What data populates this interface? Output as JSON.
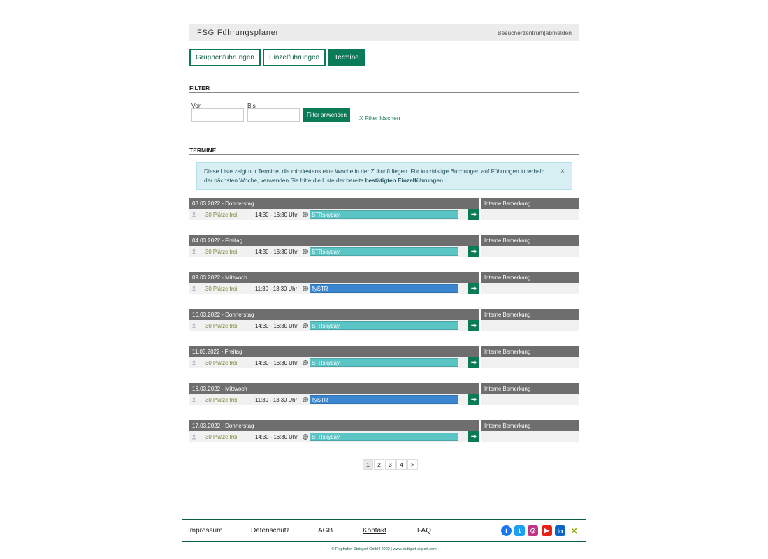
{
  "header": {
    "title": "FSG Führungsplaner",
    "visitor_center": "Besucherzentrum",
    "separator": "|",
    "logout": "abmelden"
  },
  "tabs": [
    {
      "label": "Gruppenführungen",
      "active": false
    },
    {
      "label": "Einzelführungen",
      "active": false
    },
    {
      "label": "Termine",
      "active": true
    }
  ],
  "filter": {
    "heading": "FILTER",
    "from_label": "Von",
    "to_label": "Bis",
    "from_value": "",
    "to_value": "",
    "apply_label": "Filter anwenden",
    "clear_label": "X Filter löschen"
  },
  "termine": {
    "heading": "TERMINE",
    "info_text_1": "Diese Liste zeigt nur Termine, die mindestens eine Woche in der Zukunft liegen. Für kurzfristige Buchungen auf Führungen innerhalb der nächsten Woche, verwenden Sie bitte die Liste der bereits ",
    "info_link": "bestätigten Einzelführungen",
    "info_text_2": " .",
    "close": "×",
    "remark_header": "Interne Bemerkung",
    "items": [
      {
        "date": "03.03.2022 - Donnerstag",
        "places": "30 Plätze frei",
        "time": "14:30 - 16:30 Uhr",
        "tour": "STRskyday",
        "color": "#5bc4c4"
      },
      {
        "date": "04.03.2022 - Freitag",
        "places": "30 Plätze frei",
        "time": "14:30 - 16:30 Uhr",
        "tour": "STRskyday",
        "color": "#5bc4c4"
      },
      {
        "date": "09.03.2022 - Mittwoch",
        "places": "30 Plätze frei",
        "time": "11:30 - 13:30 Uhr",
        "tour": "flySTR",
        "color": "#3a86d0"
      },
      {
        "date": "10.03.2022 - Donnerstag",
        "places": "30 Plätze frei",
        "time": "14:30 - 16:30 Uhr",
        "tour": "STRskyday",
        "color": "#5bc4c4"
      },
      {
        "date": "11.03.2022 - Freitag",
        "places": "30 Plätze frei",
        "time": "14:30 - 16:30 Uhr",
        "tour": "STRskyday",
        "color": "#5bc4c4"
      },
      {
        "date": "16.03.2022 - Mittwoch",
        "places": "30 Plätze frei",
        "time": "11:30 - 13:30 Uhr",
        "tour": "flySTR",
        "color": "#3a86d0"
      },
      {
        "date": "17.03.2022 - Donnerstag",
        "places": "30 Plätze frei",
        "time": "14:30 - 16:30 Uhr",
        "tour": "STRskyday",
        "color": "#5bc4c4"
      }
    ]
  },
  "pagination": {
    "pages": [
      "1",
      "2",
      "3",
      "4"
    ],
    "next": ">",
    "current": "1"
  },
  "footer": {
    "links": [
      {
        "label": "Impressum"
      },
      {
        "label": "Datenschutz"
      },
      {
        "label": "AGB"
      },
      {
        "label": "Kontakt"
      },
      {
        "label": "FAQ"
      }
    ],
    "social": [
      {
        "name": "facebook-icon",
        "glyph": "f",
        "color": "#1877f2"
      },
      {
        "name": "twitter-icon",
        "glyph": "t",
        "color": "#1da1f2"
      },
      {
        "name": "instagram-icon",
        "glyph": "◎",
        "color": "#c13584"
      },
      {
        "name": "youtube-icon",
        "glyph": "▶",
        "color": "#e62117"
      },
      {
        "name": "linkedin-icon",
        "glyph": "in",
        "color": "#0a66c2"
      },
      {
        "name": "xing-icon",
        "glyph": "✕",
        "color": "#026466"
      }
    ],
    "copyright": "© Flughafen Stuttgart GmbH 2022 | www.stuttgart-airport.com"
  }
}
